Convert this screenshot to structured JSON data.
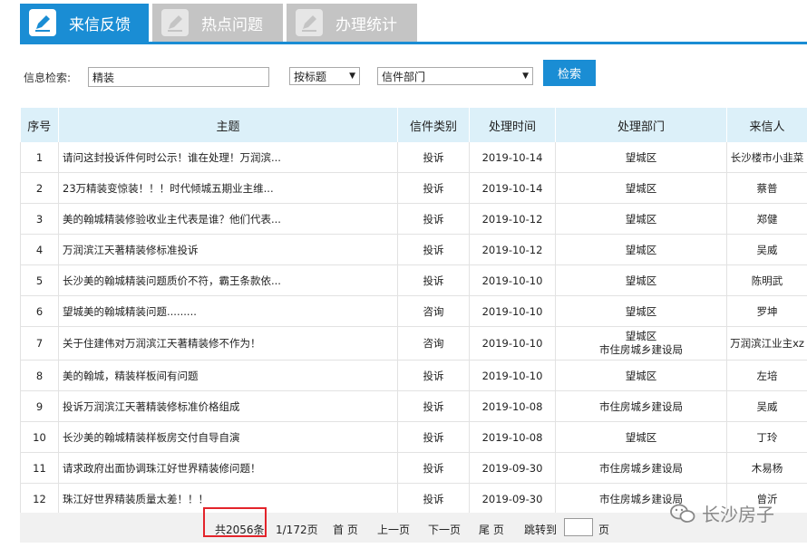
{
  "tabs": [
    {
      "label": "来信反馈",
      "active": true
    },
    {
      "label": "热点问题",
      "active": false
    },
    {
      "label": "办理统计",
      "active": false
    }
  ],
  "search": {
    "label": "信息检索:",
    "value": "精装",
    "type_select": "按标题",
    "dept_select": "信件部门",
    "button": "检索"
  },
  "table": {
    "headers": [
      "序号",
      "主题",
      "信件类别",
      "处理时间",
      "处理部门",
      "来信人"
    ],
    "rows": [
      {
        "no": "1",
        "subject": "请问这封投诉件何时公示！谁在处理！万润滨...",
        "category": "投诉",
        "date": "2019-10-14",
        "dept": "望城区",
        "dept2": "",
        "sender": "长沙楼市小韭菜"
      },
      {
        "no": "2",
        "subject": "23万精装变惊装！！！时代倾城五期业主维...",
        "category": "投诉",
        "date": "2019-10-14",
        "dept": "望城区",
        "dept2": "",
        "sender": "蔡普"
      },
      {
        "no": "3",
        "subject": "美的翰城精装修验收业主代表是谁？他们代表...",
        "category": "投诉",
        "date": "2019-10-12",
        "dept": "望城区",
        "dept2": "",
        "sender": "郑健"
      },
      {
        "no": "4",
        "subject": "万润滨江天著精装修标准投诉",
        "category": "投诉",
        "date": "2019-10-12",
        "dept": "望城区",
        "dept2": "",
        "sender": "吴威"
      },
      {
        "no": "5",
        "subject": "长沙美的翰城精装问题质价不符，霸王条款依...",
        "category": "投诉",
        "date": "2019-10-10",
        "dept": "望城区",
        "dept2": "",
        "sender": "陈明武"
      },
      {
        "no": "6",
        "subject": "望城美的翰城精装问题.........",
        "category": "咨询",
        "date": "2019-10-10",
        "dept": "望城区",
        "dept2": "",
        "sender": "罗坤"
      },
      {
        "no": "7",
        "subject": "关于住建伟对万润滨江天著精装修不作为！",
        "category": "咨询",
        "date": "2019-10-10",
        "dept": "望城区",
        "dept2": "市住房城乡建设局",
        "sender": "万润滨江业主xz"
      },
      {
        "no": "8",
        "subject": "美的翰城，精装样板间有问题",
        "category": "投诉",
        "date": "2019-10-10",
        "dept": "望城区",
        "dept2": "",
        "sender": "左培"
      },
      {
        "no": "9",
        "subject": "投诉万润滨江天著精装修标准价格组成",
        "category": "投诉",
        "date": "2019-10-08",
        "dept": "市住房城乡建设局",
        "dept2": "",
        "sender": "吴威"
      },
      {
        "no": "10",
        "subject": "长沙美的翰城精装样板房交付自导自演",
        "category": "投诉",
        "date": "2019-10-08",
        "dept": "望城区",
        "dept2": "",
        "sender": "丁玲"
      },
      {
        "no": "11",
        "subject": "请求政府出面协调珠江好世界精装修问题！",
        "category": "投诉",
        "date": "2019-09-30",
        "dept": "市住房城乡建设局",
        "dept2": "",
        "sender": "木易杨"
      },
      {
        "no": "12",
        "subject": "珠江好世界精装质量太差！！！",
        "category": "投诉",
        "date": "2019-09-30",
        "dept": "市住房城乡建设局",
        "dept2": "",
        "sender": "曾沂"
      }
    ]
  },
  "pager": {
    "total": "共2056条",
    "page": "1/172页",
    "first": "首 页",
    "prev": "上一页",
    "next": "下一页",
    "last": "尾 页",
    "jump": "跳转到",
    "page_unit": "页"
  },
  "watermark": "长沙房子",
  "colors": {
    "accent": "#1a8dd4",
    "tab_inactive": "#c4c4c4",
    "header_bg": "#dcf0f9",
    "highlight": "#e3242b"
  }
}
